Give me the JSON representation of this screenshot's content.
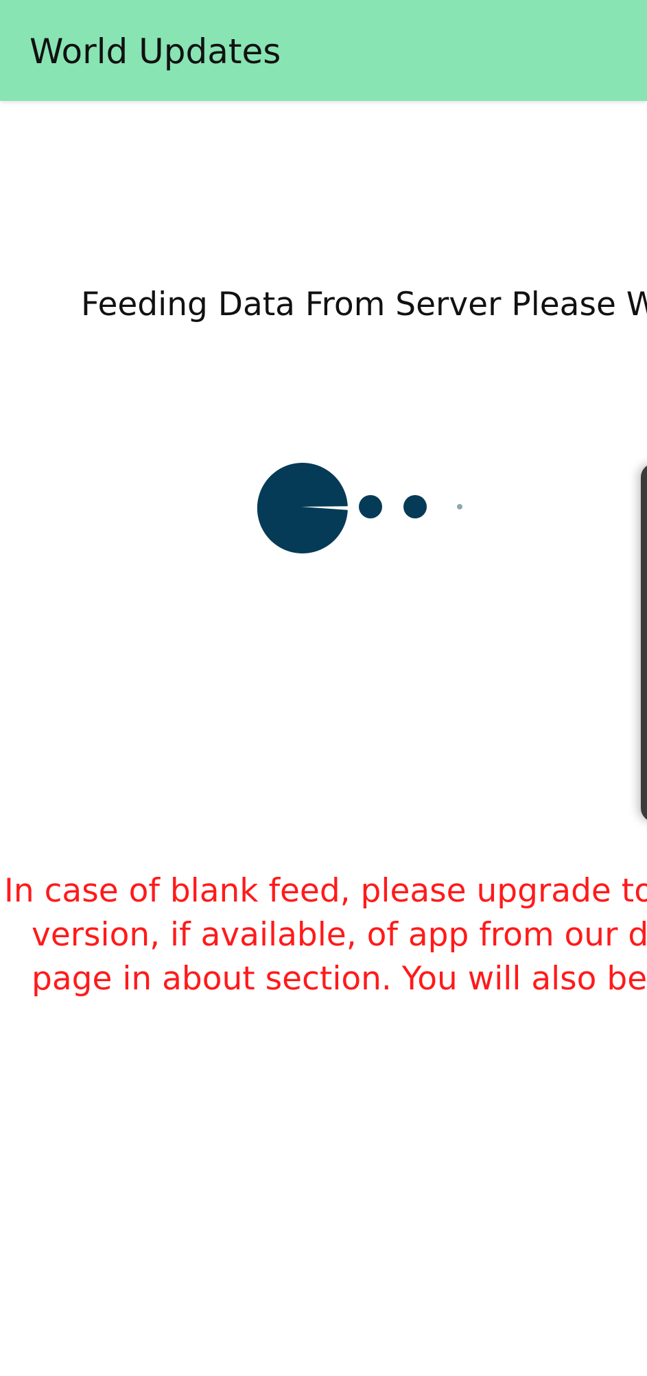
{
  "app_bar": {
    "title": "World Updates",
    "background_color": "#88e4b3"
  },
  "loading": {
    "message": "Feeding Data From Server Please Wait..",
    "indicator_icon": "pacman-loader-icon",
    "indicator_color": "#053b57"
  },
  "notice": {
    "lines": [
      "In case of blank feed, please upgrade to the",
      "version, if available, of app from our downl",
      "page in about section. You will also be not"
    ],
    "color": "#ff1a1a"
  },
  "side_panel": {
    "icon": "edge-panel-handle"
  }
}
